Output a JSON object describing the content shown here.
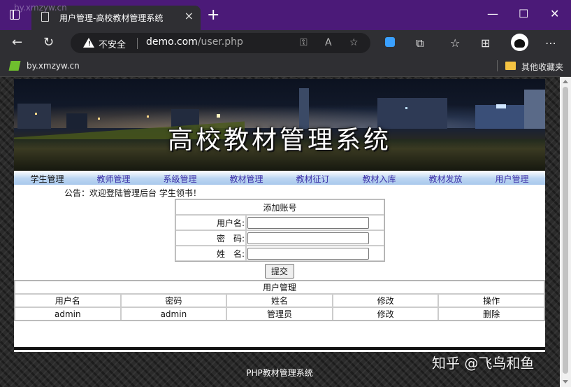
{
  "browser": {
    "tab_title": "用户管理-高校教材管理系统",
    "security_label": "不安全",
    "url_host": "demo.com",
    "url_path": "/user.php",
    "bookmark": "by.xmzyw.cn",
    "other_bookmarks": "其他收藏夹",
    "overlay_watermark": "by.xmzyw.cn"
  },
  "site": {
    "banner_title": "高校教材管理系统",
    "menu": [
      "学生管理",
      "教师管理",
      "系级管理",
      "教材管理",
      "教材征订",
      "教材入库",
      "教材发放",
      "用户管理"
    ],
    "notice": "公告：欢迎登陆管理后台 学生领书！",
    "form": {
      "title": "添加账号",
      "username_label": "用户名:",
      "password_label": "密　码:",
      "name_label": "姓　名:",
      "username_value": "",
      "password_value": "",
      "name_value": "",
      "submit_label": "提交"
    },
    "user_table": {
      "title": "用户管理",
      "columns": [
        "用户名",
        "密码",
        "姓名",
        "修改",
        "操作"
      ],
      "rows": [
        [
          "admin",
          "admin",
          "管理员",
          "修改",
          "删除"
        ]
      ]
    },
    "footer": "PHP教材管理系统",
    "corner_watermark": "知乎 @飞鸟和鱼"
  },
  "colors": {
    "titlebar": "#4b1a78",
    "chrome": "#2f2f33",
    "menu_text": "#3b2fa8"
  }
}
